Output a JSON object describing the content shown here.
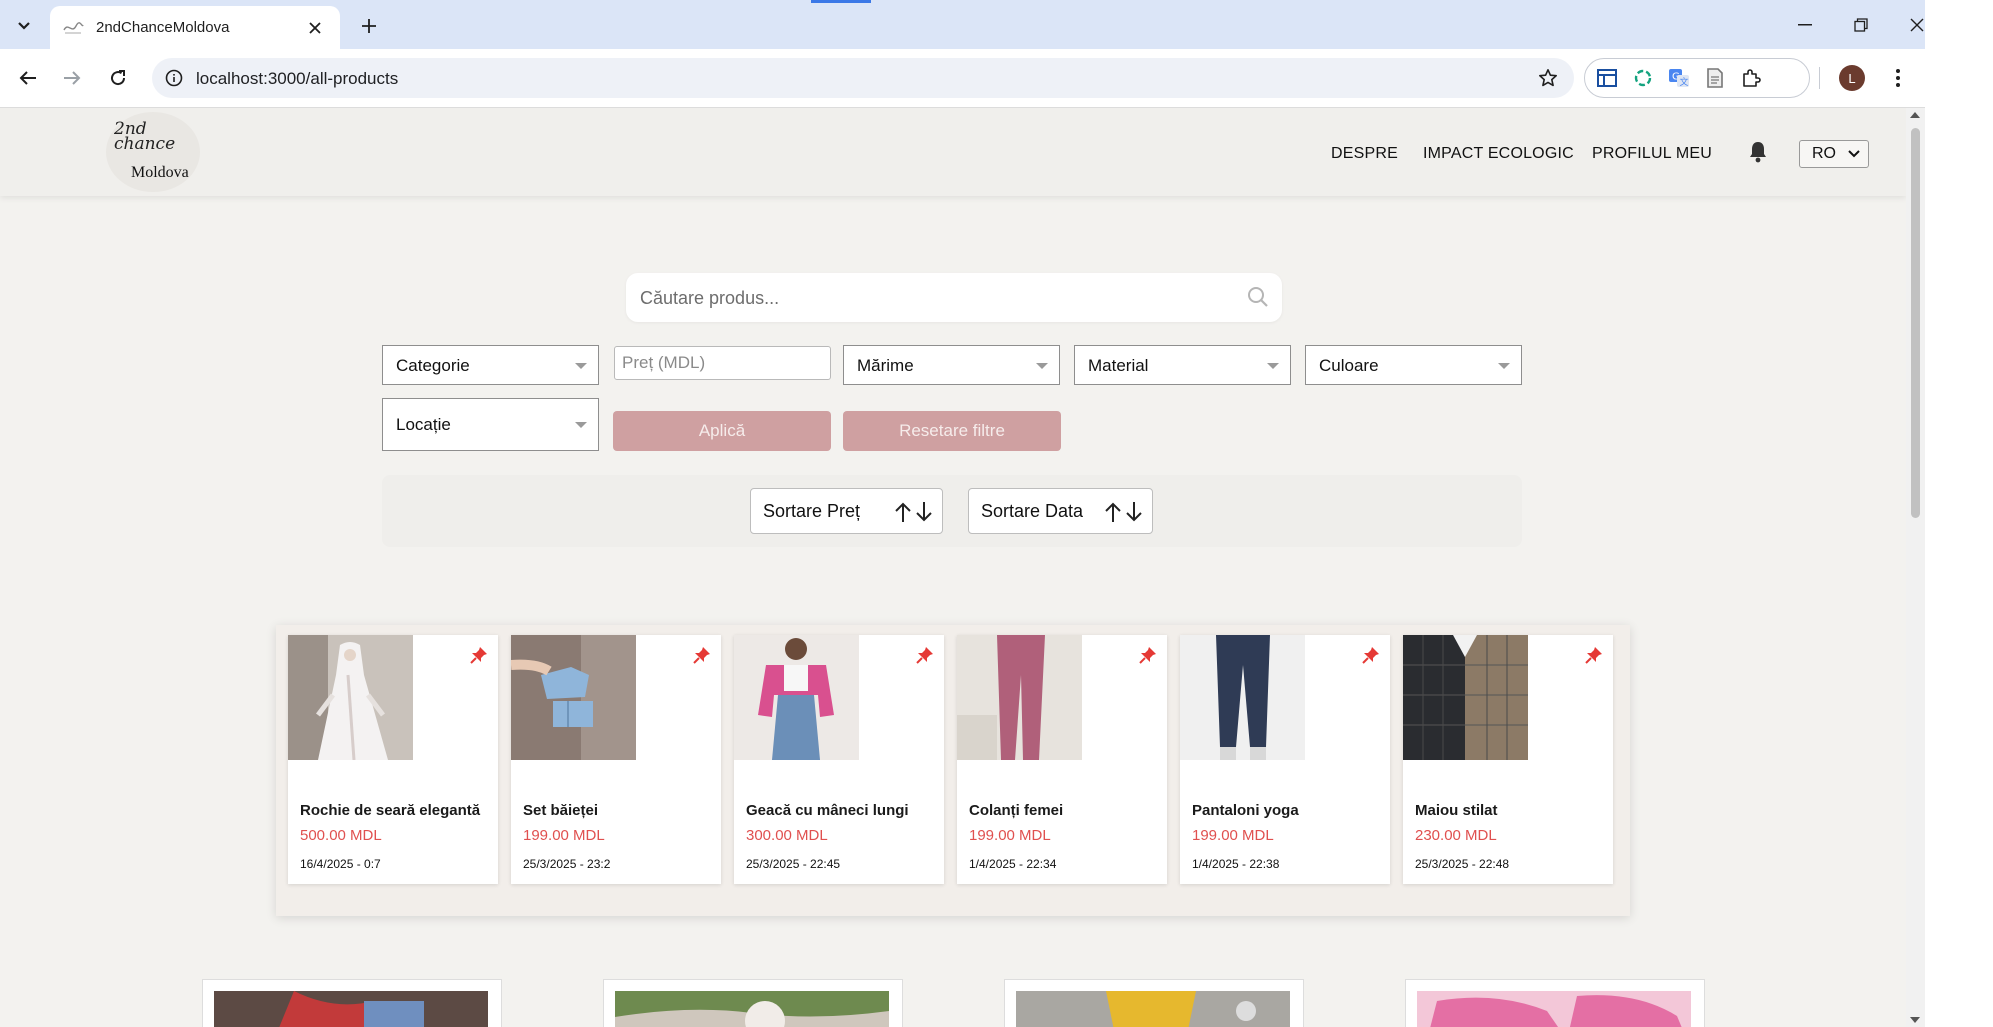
{
  "browser": {
    "tab_title": "2ndChanceMoldova",
    "url": "localhost:3000/all-products",
    "profile_initial": "L"
  },
  "header": {
    "logo_script": "2nd chance",
    "logo_word": "Moldova",
    "nav": [
      "DESPRE",
      "IMPACT ECOLOGIC",
      "PROFILUL MEU"
    ],
    "language": "RO"
  },
  "search": {
    "placeholder": "Căutare produs..."
  },
  "filters": {
    "categorie": "Categorie",
    "pret_placeholder": "Preț (MDL)",
    "marime": "Mărime",
    "material": "Material",
    "culoare": "Culoare",
    "locatie": "Locație",
    "apply": "Aplică",
    "reset": "Resetare filtre"
  },
  "sort": {
    "price": "Sortare Preț",
    "date": "Sortare Data"
  },
  "featured": [
    {
      "name": "Rochie de seară elegantă",
      "price": "500.00 MDL",
      "date": "16/4/2025 - 0:7"
    },
    {
      "name": "Set băieței",
      "price": "199.00 MDL",
      "date": "25/3/2025 - 23:2"
    },
    {
      "name": "Geacă cu mâneci lungi",
      "price": "300.00 MDL",
      "date": "25/3/2025 - 22:45"
    },
    {
      "name": "Colanți femei",
      "price": "199.00 MDL",
      "date": "1/4/2025 - 22:34"
    },
    {
      "name": "Pantaloni yoga",
      "price": "199.00 MDL",
      "date": "1/4/2025 - 22:38"
    },
    {
      "name": "Maiou stilat",
      "price": "230.00 MDL",
      "date": "25/3/2025 - 22:48"
    }
  ],
  "colors": {
    "accent_pink": "#cfa0a1",
    "price_red": "#e0504f",
    "pin_red": "#e53935"
  }
}
